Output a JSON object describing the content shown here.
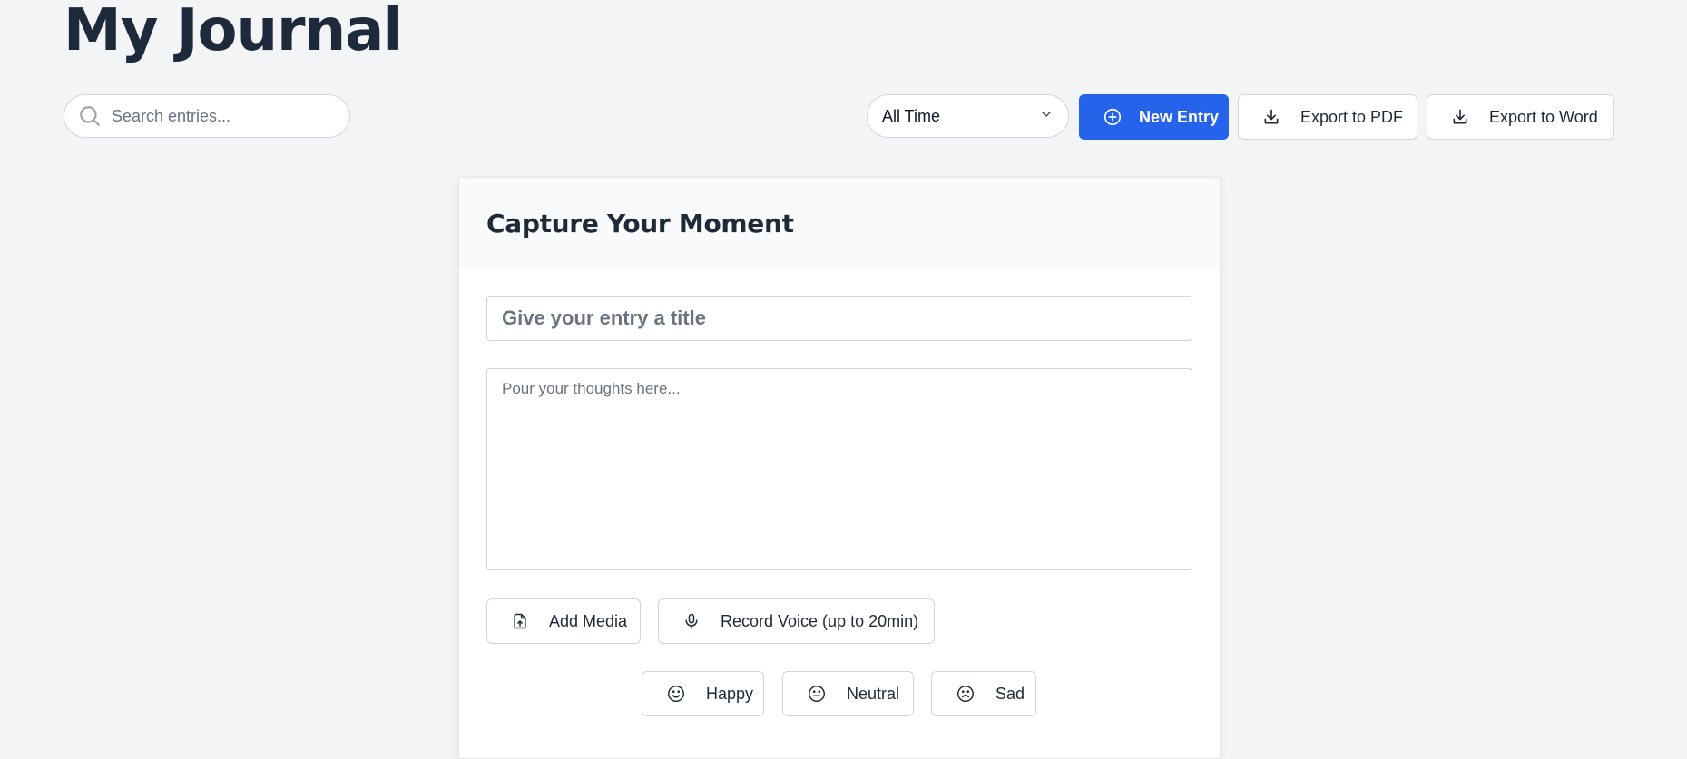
{
  "header": {
    "title": "My Journal"
  },
  "search": {
    "placeholder": "Search entries..."
  },
  "filter": {
    "selected": "All Time"
  },
  "toolbar": {
    "new_entry_label": "New Entry",
    "export_pdf_label": "Export to PDF",
    "export_word_label": "Export to Word"
  },
  "editor": {
    "heading": "Capture Your Moment",
    "title_placeholder": "Give your entry a title",
    "body_placeholder": "Pour your thoughts here...",
    "add_media_label": "Add Media",
    "record_voice_label": "Record Voice (up to 20min)"
  },
  "moods": {
    "happy": "Happy",
    "neutral": "Neutral",
    "sad": "Sad"
  },
  "colors": {
    "accent": "#2563eb",
    "background": "#f3f4f6",
    "text": "#1e293b"
  },
  "icons": {
    "search": "search-icon",
    "dropdown": "chevron-down-icon",
    "new_entry": "plus-circle-icon",
    "export": "download-icon",
    "media": "file-upload-icon",
    "voice": "microphone-icon",
    "happy": "smile-icon",
    "neutral": "neutral-face-icon",
    "sad": "frown-icon"
  }
}
